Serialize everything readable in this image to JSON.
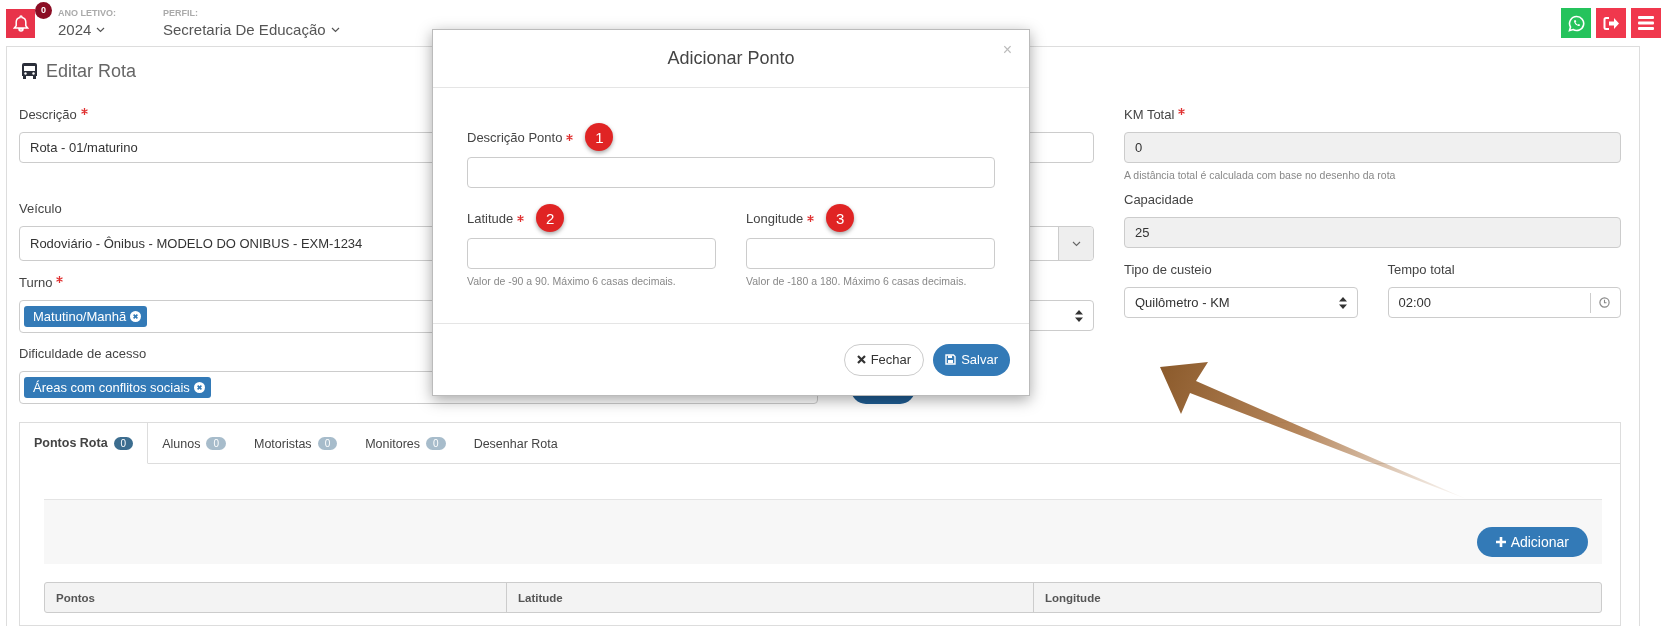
{
  "header": {
    "notification_count": "0",
    "school_year": {
      "label": "ANO LETIVO:",
      "value": "2024"
    },
    "profile": {
      "label": "PERFIL:",
      "value": "Secretaria De Educação"
    }
  },
  "page": {
    "title": "Editar Rota"
  },
  "form": {
    "descricao": {
      "label": "Descrição",
      "required": true,
      "value": "Rota - 01/maturino",
      "readonly": false
    },
    "km_total": {
      "label": "KM Total",
      "required": true,
      "value": "0",
      "readonly": true,
      "help": "A distância total é calculada com base no desenho da rota"
    },
    "veiculo": {
      "label": "Veículo",
      "value": "Rodoviário - Ônibus - MODELO DO ONIBUS - EXM-1234"
    },
    "capacidade": {
      "label": "Capacidade",
      "value": "25",
      "readonly": true
    },
    "turno": {
      "label": "Turno",
      "required": true,
      "tags": [
        "Matutino/Manhã"
      ]
    },
    "tipo_custeio": {
      "label": "Tipo de custeio",
      "value": "Quilômetro - KM"
    },
    "tempo_total": {
      "label": "Tempo total",
      "value": "02:00"
    },
    "dificuldade": {
      "label": "Dificuldade de acesso",
      "tags": [
        "Áreas com conflitos sociais"
      ]
    }
  },
  "tabs": [
    {
      "label": "Pontos Rota",
      "count": "0",
      "selected": true
    },
    {
      "label": "Alunos",
      "count": "0",
      "selected": false
    },
    {
      "label": "Motoristas",
      "count": "0",
      "selected": false
    },
    {
      "label": "Monitores",
      "count": "0",
      "selected": false
    },
    {
      "label": "Desenhar Rota",
      "selected": false
    }
  ],
  "add_button": "Adicionar",
  "table": {
    "columns": [
      "Pontos",
      "Latitude",
      "Longitude"
    ]
  },
  "modal": {
    "title": "Adicionar Ponto",
    "close": "×",
    "fields": [
      {
        "label": "Descrição Ponto",
        "required": true,
        "marker": "1"
      },
      {
        "label": "Latitude",
        "required": true,
        "marker": "2",
        "help": "Valor de -90 a 90. Máximo 6 casas decimais."
      },
      {
        "label": "Longitude",
        "required": true,
        "marker": "3",
        "help": "Valor de -180 a 180. Máximo 6 casas decimais."
      }
    ],
    "buttons": [
      {
        "kind": "close",
        "label": "Fechar"
      },
      {
        "kind": "save",
        "label": "Salvar"
      }
    ]
  }
}
